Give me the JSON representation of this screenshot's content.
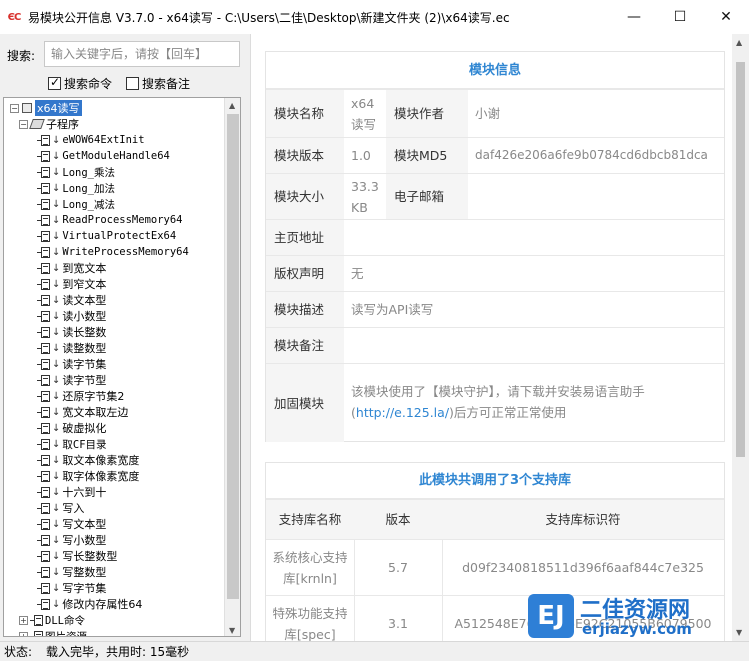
{
  "titlebar": {
    "icon": "eclogo",
    "title": "易模块公开信息 V3.7.0 - x64读写 - C:\\Users\\二佳\\Desktop\\新建文件夹 (2)\\x64读写.ec",
    "minimize": "—",
    "maximize": "☐",
    "close": "✕"
  },
  "search": {
    "label": "搜索:",
    "placeholder": "输入关键字后，请按【回车】",
    "value": "",
    "opt_commands": "搜索命令",
    "opt_commands_checked": true,
    "opt_notes": "搜索备注",
    "opt_notes_checked": false
  },
  "tree": {
    "root": "x64读写",
    "subprogram_group": "子程序",
    "items": [
      "eWOW64ExtInit",
      "GetModuleHandle64",
      "Long_乘法",
      "Long_加法",
      "Long_减法",
      "ReadProcessMemory64",
      "VirtualProtectEx64",
      "WriteProcessMemory64",
      "到宽文本",
      "到窄文本",
      "读文本型",
      "读小数型",
      "读长整数",
      "读整数型",
      "读字节集",
      "读字节型",
      "还原字节集2",
      "宽文本取左边",
      "破虚拟化",
      "取CF目录",
      "取文本像素宽度",
      "取字体像素宽度",
      "十六到十",
      "写入",
      "写文本型",
      "写小数型",
      "写长整数型",
      "写整数型",
      "写字节集",
      "修改内存属性64"
    ],
    "dll_group": "DLL命令",
    "resource_group": "图片资源"
  },
  "module_info": {
    "title": "模块信息",
    "name_label": "模块名称",
    "name_value": "x64读写",
    "author_label": "模块作者",
    "author_value": "小谢",
    "version_label": "模块版本",
    "version_value": "1.0",
    "md5_label": "模块MD5",
    "md5_value": "daf426e206a6fe9b0784cd6dbcb81dca",
    "size_label": "模块大小",
    "size_value": "33.3 KB",
    "email_label": "电子邮箱",
    "email_value": "",
    "homepage_label": "主页地址",
    "homepage_value": "",
    "copyright_label": "版权声明",
    "copyright_value": "无",
    "desc_label": "模块描述",
    "desc_value": "读写为API读写",
    "notes_label": "模块备注",
    "notes_value": "",
    "harden_label": "加固模块",
    "harden_text_before": "该模块使用了【模块守护】，请下载并安装易语言助手(",
    "harden_link": "http://e.125.la/",
    "harden_text_after": ")后方可正常正常使用"
  },
  "support_libs": {
    "title": "此模块共调用了3个支持库",
    "col_name": "支持库名称",
    "col_version": "版本",
    "col_id": "支持库标识符",
    "rows": [
      {
        "name": "系统核心支持库[krnln]",
        "version": "5.7",
        "id": "d09f2340818511d396f6aaf844c7e325"
      },
      {
        "name": "特殊功能支持库[spec]",
        "version": "3.1",
        "id": "A512548E76954B6E92C21055B6079500"
      }
    ]
  },
  "status": {
    "label": "状态:",
    "text": "载入完毕，共用时: 15毫秒"
  },
  "watermark": {
    "logo": "EJ",
    "cn": "二佳资源网",
    "url": "erjiazyw.com"
  },
  "colors": {
    "accent": "#2f86d2",
    "selection": "#3377cc"
  }
}
